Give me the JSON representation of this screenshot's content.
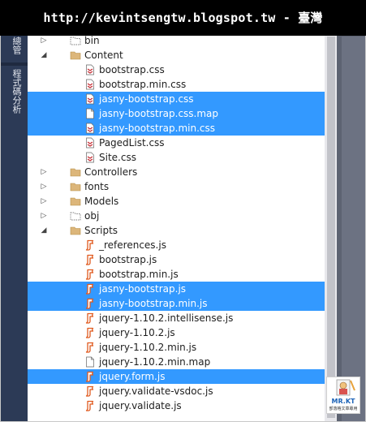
{
  "banner": {
    "url_text": "http://kevintsengtw.blogspot.tw - 臺灣"
  },
  "left_rail": {
    "tabs": [
      "總管",
      "程式碼分析"
    ]
  },
  "tree": {
    "rows": [
      {
        "label": "bin",
        "kind": "folder-dashed",
        "expander": "collapsed",
        "depth": 1,
        "selected": false
      },
      {
        "label": "Content",
        "kind": "folder",
        "expander": "expanded",
        "depth": 1,
        "selected": false
      },
      {
        "label": "bootstrap.css",
        "kind": "css",
        "expander": "none",
        "depth": 2,
        "selected": false
      },
      {
        "label": "bootstrap.min.css",
        "kind": "css",
        "expander": "none",
        "depth": 2,
        "selected": false
      },
      {
        "label": "jasny-bootstrap.css",
        "kind": "css",
        "expander": "none",
        "depth": 2,
        "selected": true
      },
      {
        "label": "jasny-bootstrap.css.map",
        "kind": "map",
        "expander": "none",
        "depth": 2,
        "selected": true
      },
      {
        "label": "jasny-bootstrap.min.css",
        "kind": "css",
        "expander": "none",
        "depth": 2,
        "selected": true
      },
      {
        "label": "PagedList.css",
        "kind": "css",
        "expander": "none",
        "depth": 2,
        "selected": false
      },
      {
        "label": "Site.css",
        "kind": "css",
        "expander": "none",
        "depth": 2,
        "selected": false
      },
      {
        "label": "Controllers",
        "kind": "folder",
        "expander": "collapsed",
        "depth": 1,
        "selected": false
      },
      {
        "label": "fonts",
        "kind": "folder",
        "expander": "collapsed",
        "depth": 1,
        "selected": false
      },
      {
        "label": "Models",
        "kind": "folder",
        "expander": "collapsed",
        "depth": 1,
        "selected": false
      },
      {
        "label": "obj",
        "kind": "folder-dashed",
        "expander": "collapsed",
        "depth": 1,
        "selected": false
      },
      {
        "label": "Scripts",
        "kind": "folder",
        "expander": "expanded",
        "depth": 1,
        "selected": false
      },
      {
        "label": "_references.js",
        "kind": "js",
        "expander": "none",
        "depth": 2,
        "selected": false
      },
      {
        "label": "bootstrap.js",
        "kind": "js",
        "expander": "none",
        "depth": 2,
        "selected": false
      },
      {
        "label": "bootstrap.min.js",
        "kind": "js",
        "expander": "none",
        "depth": 2,
        "selected": false
      },
      {
        "label": "jasny-bootstrap.js",
        "kind": "js",
        "expander": "none",
        "depth": 2,
        "selected": true
      },
      {
        "label": "jasny-bootstrap.min.js",
        "kind": "js",
        "expander": "none",
        "depth": 2,
        "selected": true
      },
      {
        "label": "jquery-1.10.2.intellisense.js",
        "kind": "js",
        "expander": "none",
        "depth": 2,
        "selected": false
      },
      {
        "label": "jquery-1.10.2.js",
        "kind": "js",
        "expander": "none",
        "depth": 2,
        "selected": false
      },
      {
        "label": "jquery-1.10.2.min.js",
        "kind": "js",
        "expander": "none",
        "depth": 2,
        "selected": false
      },
      {
        "label": "jquery-1.10.2.min.map",
        "kind": "map",
        "expander": "none",
        "depth": 2,
        "selected": false
      },
      {
        "label": "jquery.form.js",
        "kind": "js",
        "expander": "none",
        "depth": 2,
        "selected": true
      },
      {
        "label": "jquery.validate-vsdoc.js",
        "kind": "js",
        "expander": "none",
        "depth": 2,
        "selected": false
      },
      {
        "label": "jquery.validate.js",
        "kind": "js",
        "expander": "none",
        "depth": 2,
        "selected": false
      }
    ]
  },
  "logo": {
    "title": "MR.KT",
    "subtitle": "部落格文章專用"
  },
  "colors": {
    "selection": "#3399ff",
    "folder": "#dcb67a",
    "css_icon": "#c5282f",
    "js_icon": "#e05a1f",
    "rail": "#2c3a56"
  }
}
